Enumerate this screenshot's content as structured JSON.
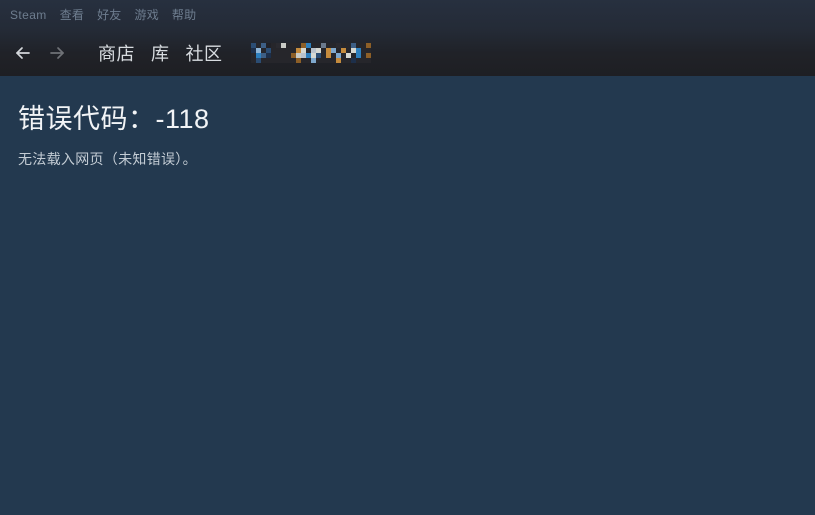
{
  "window": {
    "title": "Steam",
    "header_bg_top": "#27303f",
    "header_bg_bottom": "#1e1f23",
    "content_bg": "#23394f"
  },
  "menubar": {
    "items": [
      {
        "label": "Steam",
        "name": "menu-item-steam"
      },
      {
        "label": "查看",
        "name": "menu-item-view"
      },
      {
        "label": "好友",
        "name": "menu-item-friends"
      },
      {
        "label": "游戏",
        "name": "menu-item-games"
      },
      {
        "label": "帮助",
        "name": "menu-item-help"
      }
    ],
    "text_color": "#6e7d8f"
  },
  "navbar": {
    "back_icon": "arrow-left-icon",
    "forward_icon": "arrow-right-icon",
    "back_enabled": true,
    "forward_enabled": false,
    "links": [
      {
        "label": "商店",
        "name": "nav-link-store"
      },
      {
        "label": "库",
        "name": "nav-link-library"
      },
      {
        "label": "社区",
        "name": "nav-link-community"
      }
    ],
    "profile_name": "",
    "profile_name_censored": true,
    "text_color": "#d8dce0"
  },
  "content": {
    "error_title": "错误代码：-118",
    "error_description": "无法载入网页（未知错误）。",
    "title_color": "#f2f4f6",
    "description_color": "#c3ccd4"
  },
  "mosaic": {
    "blocks": [
      [
        0,
        0,
        "#2b4d74"
      ],
      [
        5,
        0,
        "#26262b"
      ],
      [
        10,
        0,
        "#3d5f86"
      ],
      [
        15,
        0,
        "#212127"
      ],
      [
        20,
        0,
        "#26262b"
      ],
      [
        25,
        0,
        "#2a2a30"
      ],
      [
        30,
        0,
        "#c9cbc6"
      ],
      [
        35,
        0,
        "#26262b"
      ],
      [
        40,
        0,
        "#26262b"
      ],
      [
        45,
        0,
        "#26262b"
      ],
      [
        50,
        0,
        "#8d5f27"
      ],
      [
        55,
        0,
        "#2d7fbe"
      ],
      [
        60,
        0,
        "#26262b"
      ],
      [
        65,
        0,
        "#26262b"
      ],
      [
        70,
        0,
        "#6b7a8d"
      ],
      [
        75,
        0,
        "#26262b"
      ],
      [
        80,
        0,
        "#26262b"
      ],
      [
        85,
        0,
        "#2a2a30"
      ],
      [
        90,
        0,
        "#26262b"
      ],
      [
        95,
        0,
        "#26262b"
      ],
      [
        100,
        0,
        "#3d5f86"
      ],
      [
        105,
        0,
        "#26262b"
      ],
      [
        110,
        0,
        "#26262b"
      ],
      [
        115,
        0,
        "#8d5f27"
      ],
      [
        0,
        5,
        "#1d2f4a"
      ],
      [
        5,
        5,
        "#8fb6d8"
      ],
      [
        10,
        5,
        "#26262b"
      ],
      [
        15,
        5,
        "#2b4d74"
      ],
      [
        20,
        5,
        "#26262b"
      ],
      [
        25,
        5,
        "#26262b"
      ],
      [
        30,
        5,
        "#26262b"
      ],
      [
        35,
        5,
        "#26262b"
      ],
      [
        40,
        5,
        "#26262b"
      ],
      [
        45,
        5,
        "#c58b3d"
      ],
      [
        50,
        5,
        "#d6d8d2"
      ],
      [
        55,
        5,
        "#26262b"
      ],
      [
        60,
        5,
        "#b9c2cc"
      ],
      [
        65,
        5,
        "#d6d8d2"
      ],
      [
        70,
        5,
        "#26262b"
      ],
      [
        75,
        5,
        "#c58b3d"
      ],
      [
        80,
        5,
        "#7fa8cd"
      ],
      [
        85,
        5,
        "#26262b"
      ],
      [
        90,
        5,
        "#c58b3d"
      ],
      [
        95,
        5,
        "#26262b"
      ],
      [
        100,
        5,
        "#d6d8d2"
      ],
      [
        105,
        5,
        "#2d7fbe"
      ],
      [
        110,
        5,
        "#26262b"
      ],
      [
        115,
        5,
        "#26262b"
      ],
      [
        0,
        10,
        "#26262b"
      ],
      [
        5,
        10,
        "#2d7fbe"
      ],
      [
        10,
        10,
        "#3d5f86"
      ],
      [
        15,
        10,
        "#1d2f4a"
      ],
      [
        20,
        10,
        "#26262b"
      ],
      [
        25,
        10,
        "#26262b"
      ],
      [
        30,
        10,
        "#26262b"
      ],
      [
        35,
        10,
        "#26262b"
      ],
      [
        40,
        10,
        "#8d5f27"
      ],
      [
        45,
        10,
        "#c9cbc6"
      ],
      [
        50,
        10,
        "#b9c2cc"
      ],
      [
        55,
        10,
        "#2d7fbe"
      ],
      [
        60,
        10,
        "#d6d8d2"
      ],
      [
        65,
        10,
        "#2b4d74"
      ],
      [
        70,
        10,
        "#26262b"
      ],
      [
        75,
        10,
        "#c58b3d"
      ],
      [
        80,
        10,
        "#26262b"
      ],
      [
        85,
        10,
        "#7fa8cd"
      ],
      [
        90,
        10,
        "#26262b"
      ],
      [
        95,
        10,
        "#d6d8d2"
      ],
      [
        100,
        10,
        "#26262b"
      ],
      [
        105,
        10,
        "#2d7fbe"
      ],
      [
        110,
        10,
        "#26262b"
      ],
      [
        115,
        10,
        "#8d5f27"
      ],
      [
        0,
        15,
        "#26262b"
      ],
      [
        5,
        15,
        "#2b4d74"
      ],
      [
        10,
        15,
        "#26262b"
      ],
      [
        15,
        15,
        "#26262b"
      ],
      [
        20,
        15,
        "#26262b"
      ],
      [
        25,
        15,
        "#26262b"
      ],
      [
        30,
        15,
        "#26262b"
      ],
      [
        35,
        15,
        "#26262b"
      ],
      [
        40,
        15,
        "#26262b"
      ],
      [
        45,
        15,
        "#8d5f27"
      ],
      [
        50,
        15,
        "#26262b"
      ],
      [
        55,
        15,
        "#26262b"
      ],
      [
        60,
        15,
        "#7fa8cd"
      ],
      [
        65,
        15,
        "#26262b"
      ],
      [
        70,
        15,
        "#26262b"
      ],
      [
        75,
        15,
        "#26262b"
      ],
      [
        80,
        15,
        "#26262b"
      ],
      [
        85,
        15,
        "#c58b3d"
      ],
      [
        90,
        15,
        "#26262b"
      ],
      [
        95,
        15,
        "#26262b"
      ],
      [
        100,
        15,
        "#1d2f4a"
      ],
      [
        105,
        15,
        "#26262b"
      ],
      [
        110,
        15,
        "#26262b"
      ],
      [
        115,
        15,
        "#26262b"
      ]
    ]
  }
}
